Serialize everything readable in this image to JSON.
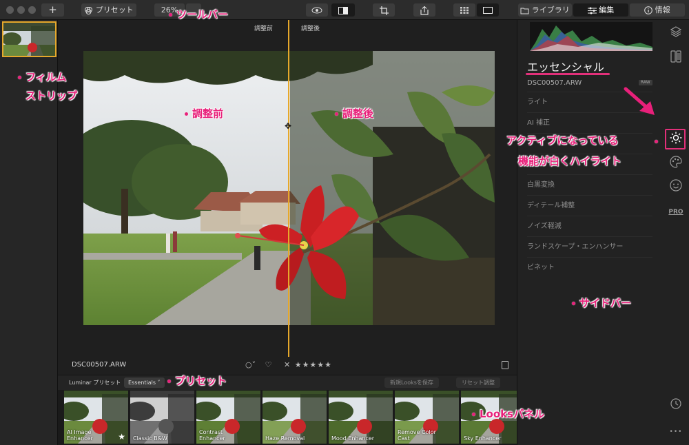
{
  "toolbar": {
    "add_label": "+",
    "presets_label": "プリセット",
    "zoom_label": "26%",
    "library_label": "ライブラリ",
    "edit_label": "編集",
    "info_label": "情報"
  },
  "compare": {
    "before_label": "調整前",
    "after_label": "調整後"
  },
  "image": {
    "filename": "DSC00507.ARW",
    "rating_stars": "★★★★★"
  },
  "preset_bar": {
    "label": "Luminar プリセット",
    "selected": "Essentials",
    "save_label": "新規Looksを保存",
    "reset_label": "リセット調整"
  },
  "looks": [
    {
      "label": "AI Image Enhancer"
    },
    {
      "label": "Classic B&W"
    },
    {
      "label": "Contrast Enhancer"
    },
    {
      "label": "Haze Removal"
    },
    {
      "label": "Mood Enhancer"
    },
    {
      "label": "Remove Color Cast"
    },
    {
      "label": "Sky Enhancer"
    }
  ],
  "sidebar": {
    "title": "エッセンシャル",
    "filename": "DSC00507.ARW",
    "raw_badge": "RAW",
    "items": [
      {
        "label": "ライト"
      },
      {
        "label": "AI 補正"
      },
      {
        "label": ""
      },
      {
        "label": ""
      },
      {
        "label": "白黒変換"
      },
      {
        "label": "ディテール補整"
      },
      {
        "label": "ノイズ軽減"
      },
      {
        "label": "ランドスケープ・エンハンサー"
      },
      {
        "label": "ビネット"
      }
    ],
    "pro_label": "PRO",
    "more_label": "•••"
  },
  "annotations": {
    "toolbar": "ツールバー",
    "filmstrip_1": "フィルム",
    "filmstrip_2": "ストリップ",
    "before": "調整前",
    "after": "調整後",
    "active_1": "アクティブになっている",
    "active_2": "機能が白くハイライト",
    "sidebar": "サイドバー",
    "presets": "プリセット",
    "looks": "Looksパネル"
  },
  "colors": {
    "accent_orange": "#e6a82b",
    "annotation_pink": "#e8207a"
  }
}
